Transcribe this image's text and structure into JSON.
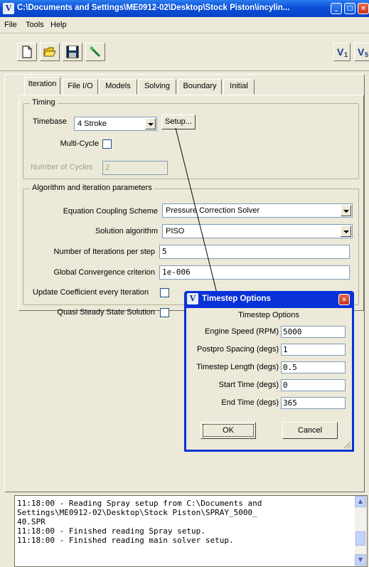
{
  "window": {
    "title": "C:\\Documents and Settings\\ME0912-02\\Desktop\\Stock Piston\\incylin...",
    "icon": "v-logo-icon",
    "controls": [
      "minimize",
      "maximize",
      "close"
    ]
  },
  "menu": {
    "items": [
      "File",
      "Tools",
      "Help"
    ]
  },
  "toolbar": {
    "buttons": [
      "new-document-icon",
      "open-folder-icon",
      "save-disk-icon",
      "wand-icon"
    ],
    "right_buttons": [
      "V1",
      "V5"
    ]
  },
  "tabs": [
    "Iteration",
    "File I/O",
    "Models",
    "Solving",
    "Boundary",
    "Initial"
  ],
  "active_tab": "Iteration",
  "timing": {
    "group_title": "Timing",
    "timebase_label": "Timebase",
    "timebase_value": "4 Stroke",
    "setup_label": "Setup...",
    "multicycle_label": "Multi-Cycle",
    "multicycle_checked": false,
    "cycles_label": "Number of Cycles",
    "cycles_value": "2"
  },
  "algorithm": {
    "group_title": "Algorithm and iteration parameters",
    "coupling_label": "Equation Coupling Scheme",
    "coupling_value": "Pressure Correction Solver",
    "solution_label": "Solution algorithm",
    "solution_value": "PISO",
    "iterations_label": "Number of Iterations per step",
    "iterations_value": "5",
    "convergence_label": "Global Convergence criterion",
    "convergence_value": "1e-006",
    "update_coeff_label": "Update Coefficient every Iteration",
    "update_coeff_checked": false,
    "quasi_label": "Quasi Steady State Solution",
    "quasi_checked": false
  },
  "log": {
    "lines": [
      "11:18:00 - Reading Spray setup from C:\\Documents and",
      "Settings\\ME0912-02\\Desktop\\Stock Piston\\SPRAY_5000_",
      "40.SPR",
      "11:18:00 - Finished reading Spray setup.",
      "11:18:00 - Finished reading main solver setup."
    ]
  },
  "dialog": {
    "title": "Timestep Options",
    "heading": "Timestep Options",
    "engine_speed_label": "Engine Speed (RPM)",
    "engine_speed_value": "5000",
    "postpro_label": "Postpro Spacing (degs)",
    "postpro_value": "1",
    "timestep_label": "Timestep Length (degs)",
    "timestep_value": "0.5",
    "start_label": "Start Time (degs)",
    "start_value": "0",
    "end_label": "End Time (degs)",
    "end_value": "365",
    "ok_label": "OK",
    "cancel_label": "Cancel"
  },
  "colors": {
    "titlebar": "#0a4fd8",
    "dialog_frame": "#0831d9",
    "window_bg": "#ece9d8",
    "close_button": "#c9331b"
  }
}
